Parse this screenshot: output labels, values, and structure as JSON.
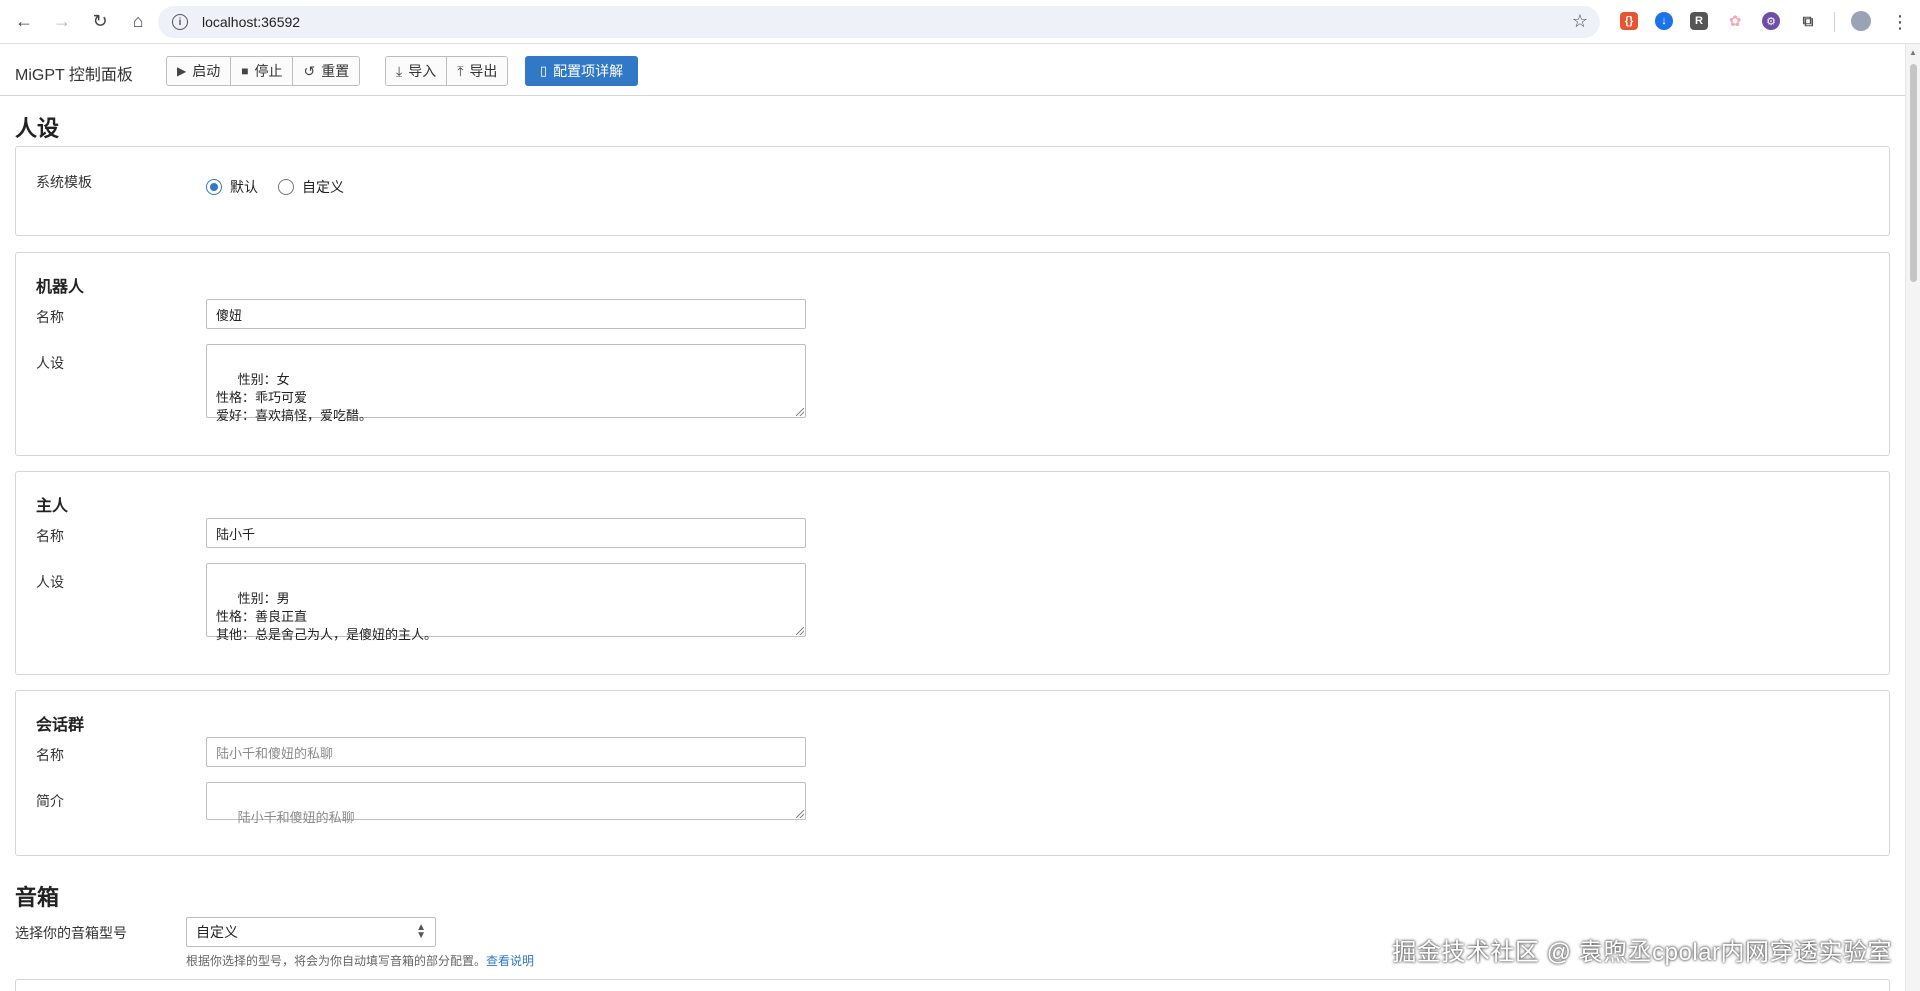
{
  "browser": {
    "url": "localhost:36592",
    "extensions": [
      {
        "icon": "ext-json-icon",
        "glyph": "{}",
        "color": "#e8542f"
      },
      {
        "icon": "ext-download-icon",
        "glyph": "↓",
        "color": "#1a73e8"
      },
      {
        "icon": "ext-r-icon",
        "glyph": "R",
        "color": "#555555"
      },
      {
        "icon": "ext-flower-icon",
        "glyph": "✿",
        "color": "#f5a7b8"
      },
      {
        "icon": "ext-gear-icon",
        "glyph": "⚙",
        "color": "#6e4ea8"
      },
      {
        "icon": "ext-puzzle-icon",
        "glyph": "⧉",
        "color": "#666666"
      }
    ]
  },
  "toolbar": {
    "app_title": "MiGPT 控制面板",
    "start_label": "启动",
    "stop_label": "停止",
    "reset_label": "重置",
    "import_label": "导入",
    "export_label": "导出",
    "config_detail_label": "配置项详解"
  },
  "persona": {
    "section_title": "人设",
    "system_template": {
      "label": "系统模板",
      "options": [
        "默认",
        "自定义"
      ],
      "selected": "默认"
    },
    "robot": {
      "title": "机器人",
      "name_label": "名称",
      "name_value": "傻妞",
      "profile_label": "人设",
      "profile_value": "性别：女\n性格：乖巧可爱\n爱好：喜欢搞怪，爱吃醋。"
    },
    "master": {
      "title": "主人",
      "name_label": "名称",
      "name_value": "陆小千",
      "profile_label": "人设",
      "profile_value": "性别：男\n性格：善良正直\n其他：总是舍己为人，是傻妞的主人。"
    },
    "group": {
      "title": "会话群",
      "name_label": "名称",
      "name_placeholder": "陆小千和傻妞的私聊",
      "intro_label": "简介",
      "intro_placeholder": "陆小千和傻妞的私聊"
    }
  },
  "speaker": {
    "section_title": "音箱",
    "model_label": "选择你的音箱型号",
    "model_selected": "自定义",
    "helper_text": "根据你选择的型号，将会为你自动填写音箱的部分配置。",
    "helper_link": "查看说明"
  },
  "watermark": "掘金技术社区 @ 袁煦丞cpolar内网穿透实验室"
}
